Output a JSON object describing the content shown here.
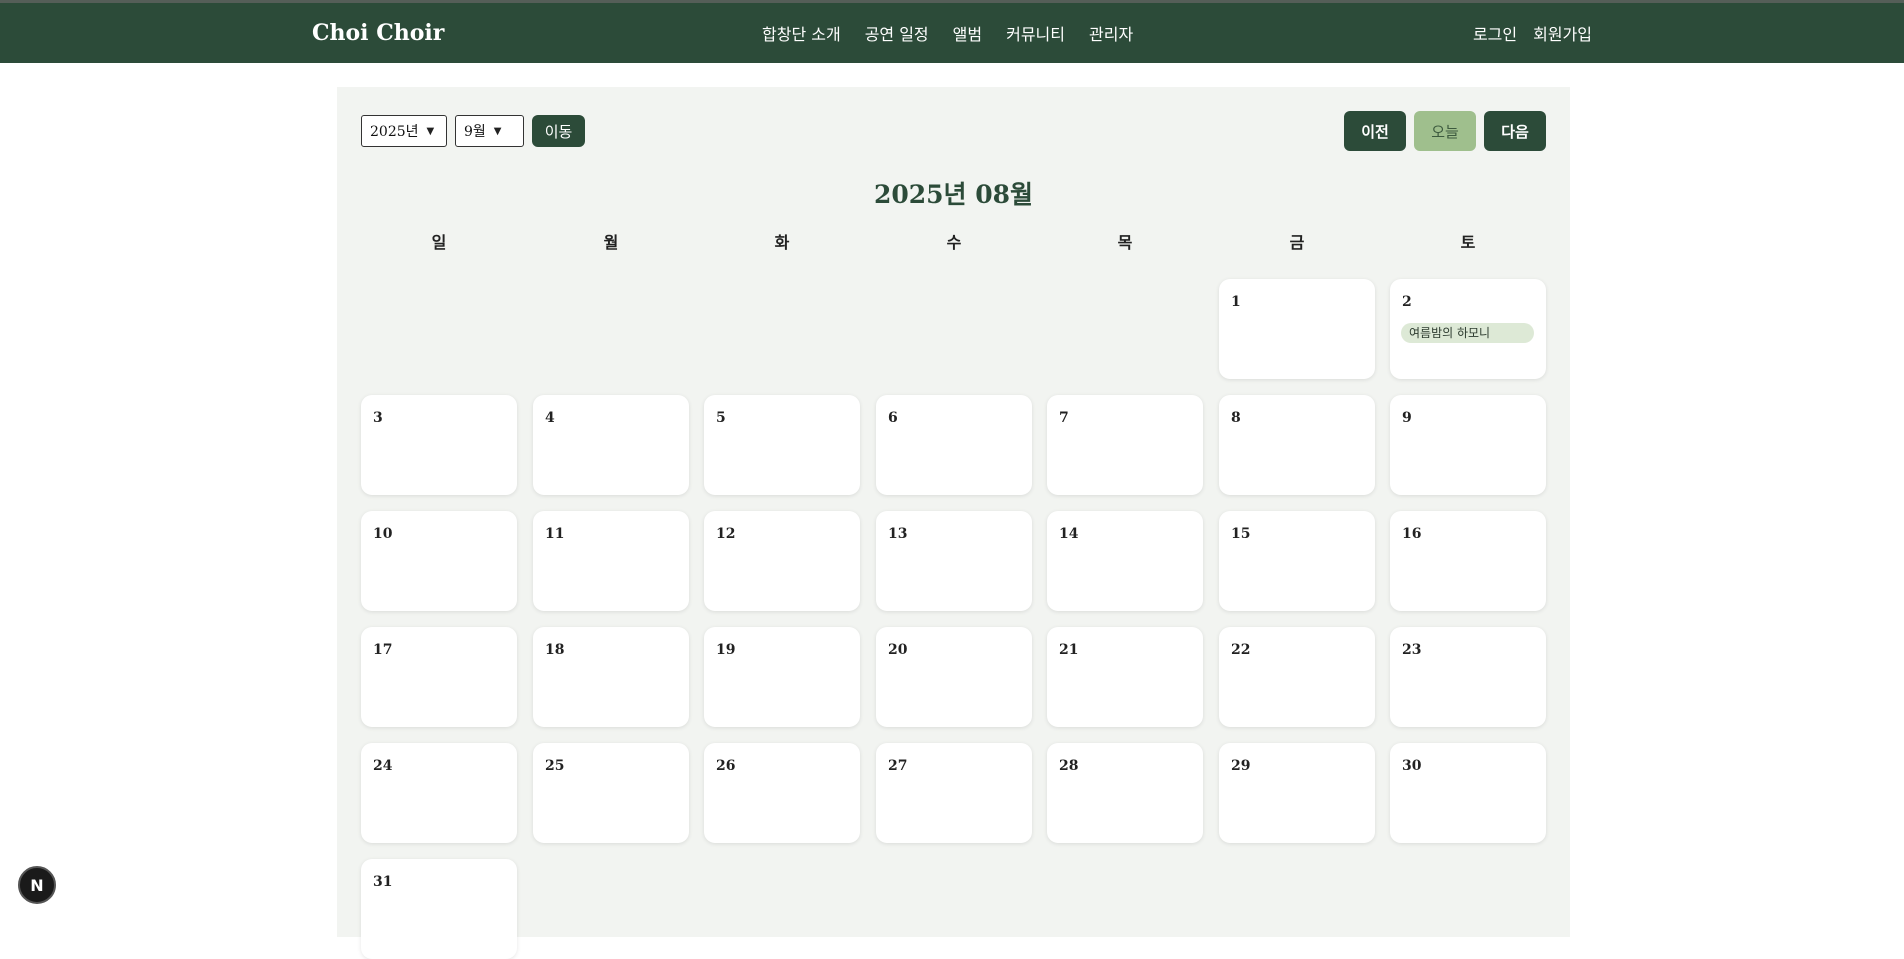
{
  "header": {
    "brand": "Choi Choir",
    "nav": [
      "합창단 소개",
      "공연 일정",
      "앨범",
      "커뮤니티",
      "관리자"
    ],
    "auth": [
      "로그인",
      "회원가입"
    ]
  },
  "controls": {
    "year_select": "2025년",
    "month_select": "9월",
    "go_label": "이동",
    "prev_label": "이전",
    "today_label": "오늘",
    "next_label": "다음"
  },
  "calendar": {
    "title": "2025년 08월",
    "weekdays": [
      "일",
      "월",
      "화",
      "수",
      "목",
      "금",
      "토"
    ],
    "first_weekday_index": 5,
    "days": [
      "1",
      "2",
      "3",
      "4",
      "5",
      "6",
      "7",
      "8",
      "9",
      "10",
      "11",
      "12",
      "13",
      "14",
      "15",
      "16",
      "17",
      "18",
      "19",
      "20",
      "21",
      "22",
      "23",
      "24",
      "25",
      "26",
      "27",
      "28",
      "29",
      "30",
      "31"
    ],
    "events": {
      "2": "여름밤의 하모니"
    }
  },
  "badge": {
    "label": "N"
  },
  "colors": {
    "header_bg": "#2c4b39",
    "panel_bg": "#f2f4f1",
    "today_button": "#9fbf8d",
    "event_pill": "#dde9d6"
  }
}
